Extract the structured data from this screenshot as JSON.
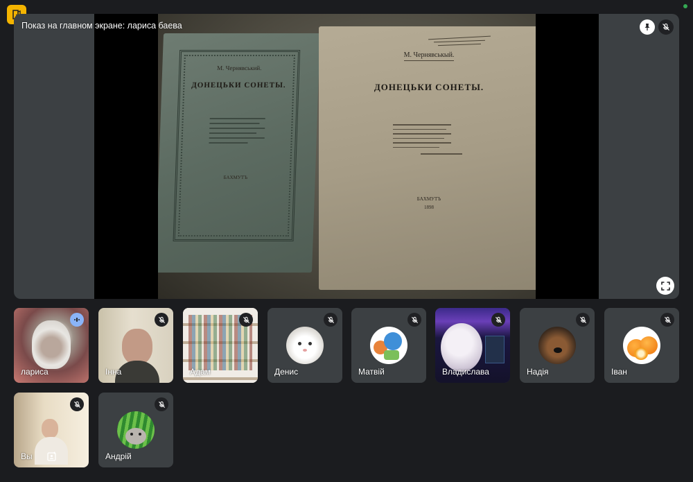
{
  "app": {
    "badge_icon": "door-exit-icon",
    "badge_color": "#f4b400",
    "status_color": "#34a853"
  },
  "stage": {
    "label": "Показ на главном экране: лариса баева",
    "pin_icon": "pin-icon",
    "mute_icon": "mic-off-icon",
    "fullscreen_icon": "fullscreen-icon",
    "book_left": {
      "author": "М. Чернявський.",
      "title": "ДОНЕЦЬКИ СОНЕТЫ.",
      "city": "БАХМУТЪ"
    },
    "book_right": {
      "author": "М. Чернявськый.",
      "title": "ДОНЕЦЬКИ СОНЕТЫ.",
      "city": "БАХМУТЪ",
      "year": "1898"
    }
  },
  "participants": [
    {
      "name": "лариса",
      "state": "speaking",
      "kind": "video"
    },
    {
      "name": "Інна",
      "state": "muted",
      "kind": "video"
    },
    {
      "name": "Адам",
      "state": "muted",
      "kind": "video"
    },
    {
      "name": "Денис",
      "state": "muted",
      "kind": "avatar",
      "avatar": "white-cat"
    },
    {
      "name": "Матвій",
      "state": "muted",
      "kind": "avatar",
      "avatar": "cartoon"
    },
    {
      "name": "Владислава",
      "state": "muted",
      "kind": "video"
    },
    {
      "name": "Надія",
      "state": "muted",
      "kind": "avatar",
      "avatar": "dog"
    },
    {
      "name": "Іван",
      "state": "muted",
      "kind": "avatar",
      "avatar": "oranges"
    },
    {
      "name": "Вы",
      "state": "muted",
      "kind": "video"
    },
    {
      "name": "Андрій",
      "state": "muted",
      "kind": "avatar",
      "avatar": "watermelon-cat"
    }
  ],
  "colors": {
    "background": "#1b1c1f",
    "tile": "#3c4043",
    "speaking": "#8ab4f8"
  }
}
